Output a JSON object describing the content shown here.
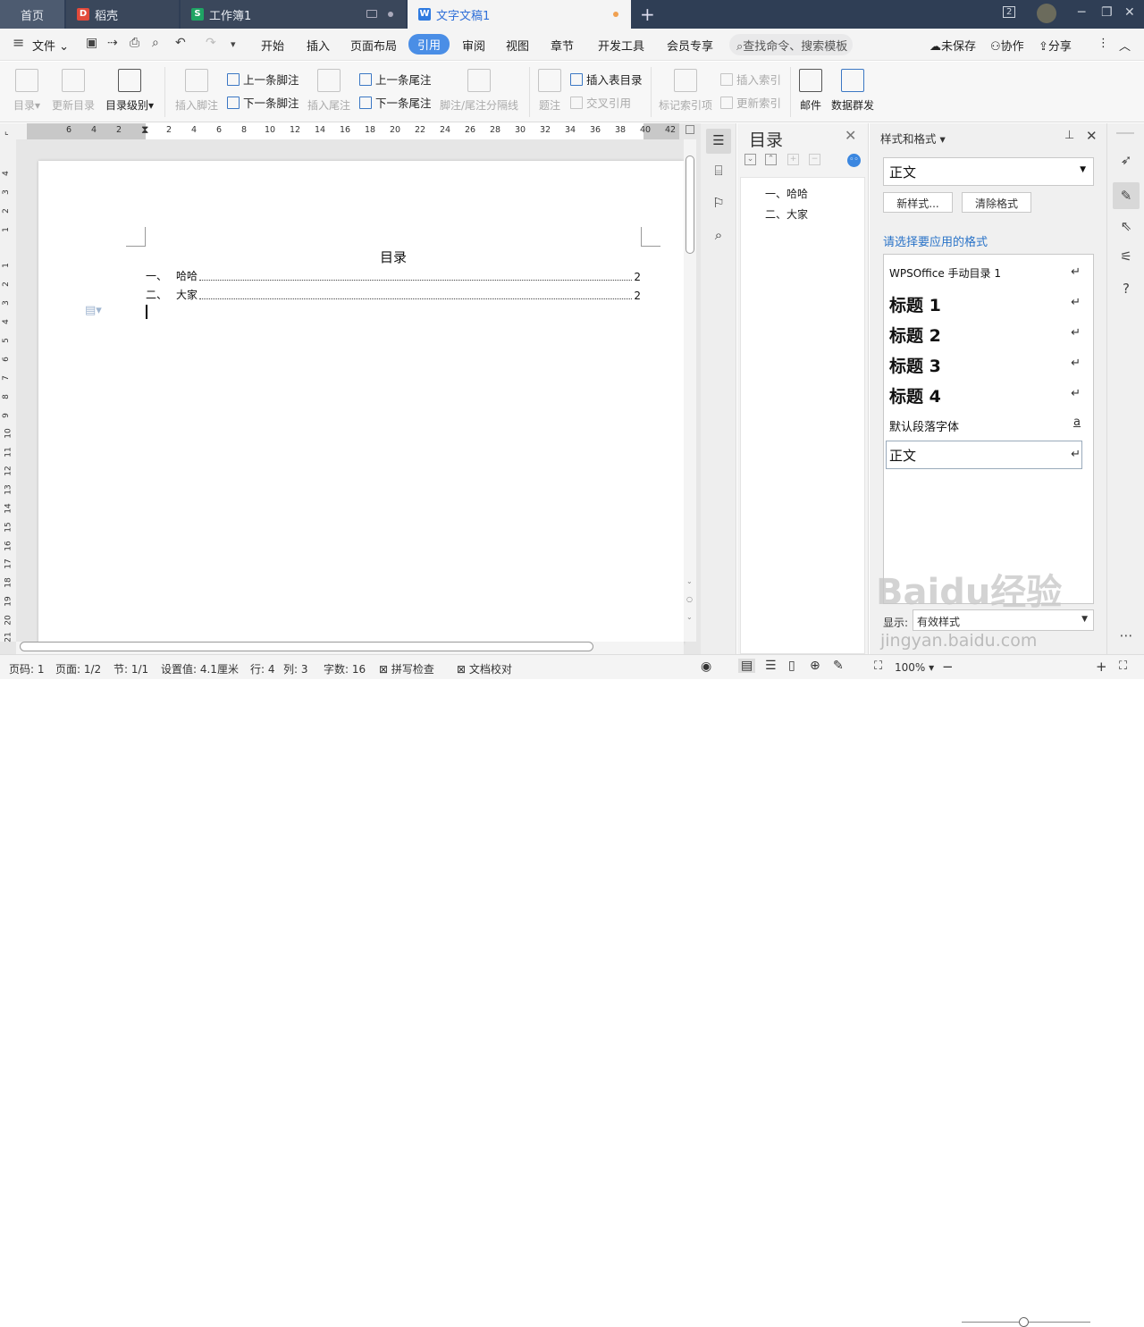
{
  "tabs": [
    {
      "label": "首页"
    },
    {
      "label": "稻壳"
    },
    {
      "label": "工作簿1"
    },
    {
      "label": "文字文稿1"
    }
  ],
  "titlebar": {
    "window_count": "2"
  },
  "menu": {
    "file": "文件",
    "items": [
      "开始",
      "插入",
      "页面布局",
      "引用",
      "审阅",
      "视图",
      "章节",
      "开发工具",
      "会员专享"
    ],
    "active": "引用",
    "search_placeholder": "查找命令、搜索模板",
    "unsaved": "未保存",
    "collab": "协作",
    "share": "分享"
  },
  "ribbon": {
    "toc": "目录",
    "update_toc": "更新目录",
    "toc_level": "目录级别",
    "insert_footnote": "插入脚注",
    "prev_footnote": "上一条脚注",
    "next_footnote": "下一条脚注",
    "insert_endnote": "插入尾注",
    "prev_endnote": "上一条尾注",
    "next_endnote": "下一条尾注",
    "footnote_sep": "脚注/尾注分隔线",
    "caption": "题注",
    "insert_table_toc": "插入表目录",
    "cross_ref": "交叉引用",
    "mark_index": "标记索引项",
    "insert_index": "插入索引",
    "update_index": "更新索引",
    "mail": "邮件",
    "data_mass": "数据群发"
  },
  "ruler": {
    "h": [
      "6",
      "4",
      "2",
      "2",
      "4",
      "6",
      "8",
      "10",
      "12",
      "14",
      "16",
      "18",
      "20",
      "22",
      "24",
      "26",
      "28",
      "30",
      "32",
      "34",
      "36",
      "38",
      "40",
      "42"
    ],
    "v": [
      "4",
      "3",
      "2",
      "1",
      "1",
      "2",
      "3",
      "4",
      "5",
      "6",
      "7",
      "8",
      "9",
      "10",
      "11",
      "12",
      "13",
      "14",
      "15",
      "16",
      "17",
      "18",
      "19",
      "20",
      "21"
    ]
  },
  "document": {
    "toc_title": "目录",
    "entries": [
      {
        "num": "一、",
        "text": "哈哈",
        "page": "2"
      },
      {
        "num": "二、",
        "text": "大家",
        "page": "2"
      }
    ]
  },
  "nav": {
    "title": "目录",
    "items": [
      "一、哈哈",
      "二、大家"
    ]
  },
  "styles_pane": {
    "title": "样式和格式",
    "current": "正文",
    "new_style": "新样式...",
    "clear_format": "清除格式",
    "prompt": "请选择要应用的格式",
    "list": [
      {
        "name": "WPSOffice 手动目录 1",
        "mark": "↵"
      },
      {
        "name": "标题 1",
        "mark": "↵"
      },
      {
        "name": "标题 2",
        "mark": "↵"
      },
      {
        "name": "标题 3",
        "mark": "↵"
      },
      {
        "name": "标题 4",
        "mark": "↵"
      },
      {
        "name": "默认段落字体",
        "mark": "a"
      },
      {
        "name": "正文",
        "mark": "↵"
      }
    ],
    "show_label": "显示:",
    "show_value": "有效样式"
  },
  "status": {
    "page_code": "页码: 1",
    "page": "页面: 1/2",
    "section": "节: 1/1",
    "setting": "设置值: 4.1厘米",
    "row": "行: 4",
    "col": "列: 3",
    "words": "字数: 16",
    "spell": "拼写检查",
    "proof": "文档校对",
    "zoom": "100%"
  },
  "watermark": {
    "logo": "Baidu经验",
    "url": "jingyan.baidu.com"
  },
  "colors": {
    "titlebar": "#2f3e55",
    "accent": "#4a8ee6",
    "link": "#2a73c8"
  }
}
